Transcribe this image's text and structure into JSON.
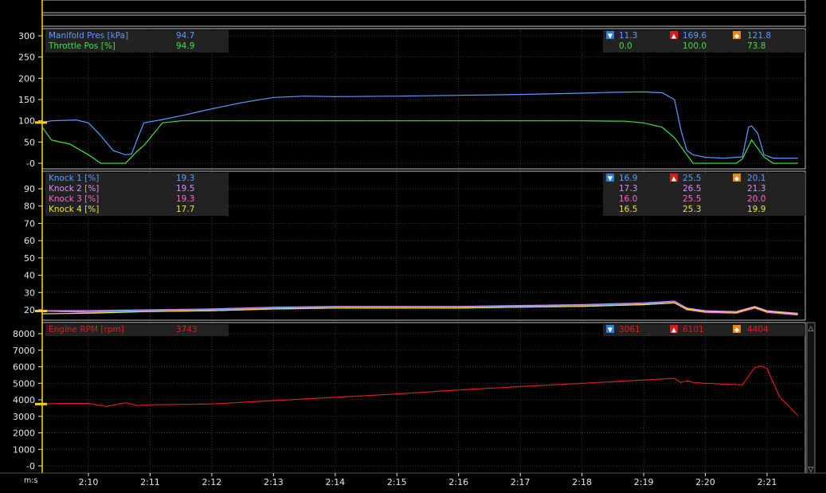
{
  "colors": {
    "background": "#000000",
    "grid": "#3a3a3a",
    "panel_border": "#bfbfbf",
    "axis_text": "#e6e6e6",
    "cursor": "#ffd400",
    "legend_bg": "#222222",
    "min_icon": "#2d7fd8",
    "max_icon": "#d81c1c",
    "avg_icon": "#e08a1a"
  },
  "time_axis": {
    "unit_label": "m:s",
    "tick_labels": [
      "2:10",
      "2:11",
      "2:12",
      "2:13",
      "2:14",
      "2:15",
      "2:16",
      "2:17",
      "2:18",
      "2:19",
      "2:20",
      "2:21"
    ]
  },
  "chart_data": [
    {
      "type": "line",
      "panel": "manifold-throttle",
      "ylim": [
        -10,
        310
      ],
      "y_ticks": [
        300,
        250,
        200,
        150,
        100,
        50,
        0
      ],
      "y_tick_labels": [
        "300",
        "250",
        "200",
        "150",
        "100",
        "50",
        "-0"
      ],
      "cursor_time_s": 129.0,
      "series": [
        {
          "name": "Manifold Pres [kPa]",
          "color": "#5b9bff",
          "current": "94.7",
          "min": "11.3",
          "max": "169.6",
          "avg": "121.8",
          "x": [
            129.0,
            129.4,
            129.8,
            130.0,
            130.2,
            130.4,
            130.6,
            130.7,
            130.8,
            130.9,
            131.2,
            131.6,
            132.0,
            132.5,
            133.0,
            133.5,
            134.0,
            135.0,
            136.0,
            137.0,
            138.0,
            138.5,
            139.0,
            139.3,
            139.5,
            139.6,
            139.7,
            139.8,
            140.0,
            140.3,
            140.6,
            140.7,
            140.75,
            140.85,
            140.95,
            141.1,
            141.5
          ],
          "y": [
            96,
            100,
            102,
            95,
            65,
            30,
            20,
            22,
            60,
            95,
            103,
            115,
            128,
            143,
            155,
            158,
            157,
            158,
            160,
            162,
            165,
            167,
            168,
            166,
            150,
            80,
            30,
            20,
            14,
            12,
            15,
            85,
            88,
            70,
            20,
            12,
            12
          ]
        },
        {
          "name": "Throttle Pos [%]",
          "color": "#3ee23e",
          "current": "94.9",
          "min": "0.0",
          "max": "100.0",
          "avg": "73.8",
          "x": [
            129.0,
            129.2,
            129.4,
            129.7,
            130.0,
            130.2,
            130.6,
            130.8,
            130.9,
            131.2,
            131.5,
            132.0,
            133.0,
            134.0,
            135.0,
            136.0,
            137.0,
            138.0,
            138.7,
            139.0,
            139.3,
            139.5,
            139.7,
            139.8,
            140.0,
            140.5,
            140.6,
            140.75,
            140.95,
            141.1,
            141.5
          ],
          "y": [
            94,
            85,
            55,
            45,
            20,
            0,
            0,
            30,
            42,
            95,
            100,
            100,
            100,
            100,
            100,
            100,
            100,
            100,
            99,
            95,
            85,
            60,
            20,
            0,
            0,
            0,
            10,
            55,
            15,
            0,
            0
          ]
        }
      ]
    },
    {
      "type": "line",
      "panel": "knock",
      "ylim": [
        15,
        103
      ],
      "y_ticks": [
        90,
        80,
        70,
        60,
        50,
        40,
        30,
        20
      ],
      "y_tick_labels": [
        "90",
        "80",
        "70",
        "60",
        "50",
        "40",
        "30",
        "20"
      ],
      "cursor_time_s": 129.0,
      "series": [
        {
          "name": "Knock 1 [%]",
          "color": "#5b9bff",
          "current": "19.3",
          "min": "16.9",
          "max": "25.5",
          "avg": "20.1",
          "x": [
            129.0,
            130.0,
            131.0,
            132.0,
            133.0,
            134.0,
            135.0,
            136.0,
            137.0,
            138.0,
            139.0,
            139.5,
            139.7,
            140.0,
            140.5,
            140.8,
            141.0,
            141.5
          ],
          "y": [
            19.3,
            19.0,
            19.5,
            20.0,
            21.0,
            21.5,
            21.5,
            21.5,
            22.0,
            22.5,
            23.5,
            24.5,
            20.0,
            19.0,
            18.5,
            21.0,
            19.0,
            17.5
          ]
        },
        {
          "name": "Knock 2 [%]",
          "color": "#d98cff",
          "current": "19.5",
          "min": "17.3",
          "max": "26.5",
          "avg": "21.3",
          "x": [
            129.0,
            130.0,
            131.0,
            132.0,
            133.0,
            134.0,
            135.0,
            136.0,
            137.0,
            138.0,
            139.0,
            139.5,
            139.7,
            140.0,
            140.5,
            140.8,
            141.0,
            141.5
          ],
          "y": [
            19.5,
            19.5,
            20.0,
            20.5,
            21.5,
            22.0,
            22.0,
            22.0,
            22.5,
            23.0,
            24.0,
            25.0,
            21.0,
            19.5,
            19.0,
            22.0,
            19.5,
            18.0
          ]
        },
        {
          "name": "Knock 3 [%]",
          "color": "#ff66cc",
          "current": "19.3",
          "min": "16.0",
          "max": "25.5",
          "avg": "20.0",
          "x": [
            129.0,
            130.0,
            131.0,
            132.0,
            133.0,
            134.0,
            135.0,
            136.0,
            137.0,
            138.0,
            139.0,
            139.5,
            139.7,
            140.0,
            140.5,
            140.8,
            141.0,
            141.5
          ],
          "y": [
            19.3,
            18.5,
            19.0,
            19.5,
            20.5,
            21.0,
            21.0,
            21.0,
            21.5,
            22.0,
            23.0,
            24.0,
            20.0,
            18.5,
            18.0,
            21.0,
            18.5,
            17.0
          ]
        },
        {
          "name": "Knock 4 [%]",
          "color": "#e6e62e",
          "current": "17.7",
          "min": "16.5",
          "max": "25.3",
          "avg": "19.9",
          "x": [
            129.0,
            130.0,
            131.0,
            132.0,
            133.0,
            134.0,
            135.0,
            136.0,
            137.0,
            138.0,
            139.0,
            139.5,
            139.7,
            140.0,
            140.5,
            140.8,
            141.0,
            141.5
          ],
          "y": [
            17.7,
            18.0,
            19.0,
            19.5,
            20.5,
            21.0,
            21.0,
            21.0,
            21.5,
            22.0,
            23.0,
            24.0,
            20.5,
            19.0,
            18.5,
            21.5,
            19.0,
            17.5
          ]
        }
      ]
    },
    {
      "type": "line",
      "panel": "engine-rpm",
      "ylim": [
        -200,
        8400
      ],
      "y_ticks": [
        8000,
        7000,
        6000,
        5000,
        4000,
        3000,
        2000,
        1000,
        0
      ],
      "y_tick_labels": [
        "8000",
        "7000",
        "6000",
        "5000",
        "4000",
        "3000",
        "2000",
        "1000",
        "-0"
      ],
      "cursor_time_s": 129.0,
      "series": [
        {
          "name": "Engine RPM [rpm]",
          "color": "#e01b1b",
          "current": "3743",
          "min": "3061",
          "max": "6101",
          "avg": "4404",
          "x": [
            129.0,
            129.5,
            130.0,
            130.3,
            130.6,
            130.8,
            131.0,
            132.0,
            133.0,
            134.0,
            135.0,
            136.0,
            137.0,
            138.0,
            139.0,
            139.5,
            139.6,
            139.7,
            139.8,
            140.0,
            140.3,
            140.6,
            140.8,
            140.9,
            141.0,
            141.2,
            141.5
          ],
          "y": [
            3743,
            3780,
            3780,
            3600,
            3820,
            3650,
            3700,
            3750,
            3950,
            4150,
            4350,
            4600,
            4800,
            5000,
            5200,
            5300,
            5050,
            5150,
            5050,
            5000,
            4950,
            4900,
            5950,
            6050,
            5900,
            4200,
            3061
          ]
        }
      ]
    }
  ]
}
